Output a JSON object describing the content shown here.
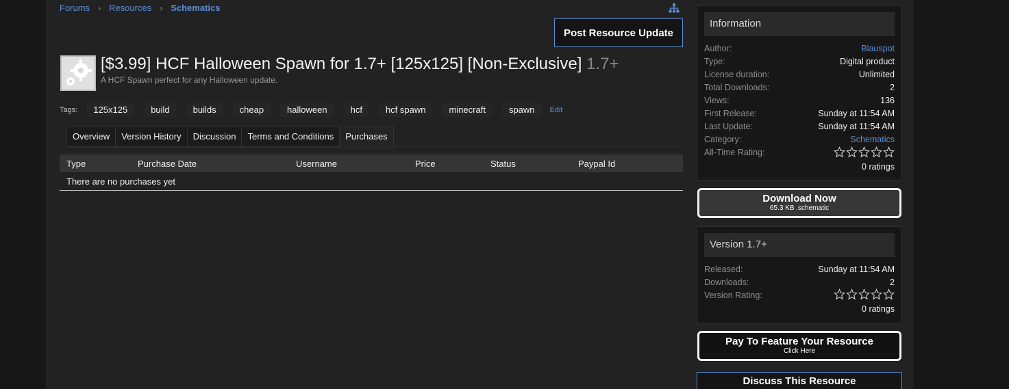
{
  "breadcrumb": {
    "items": [
      "Forums",
      "Resources"
    ],
    "current": "Schematics"
  },
  "post_button": "Post Resource Update",
  "resource": {
    "title": "[$3.99] HCF Halloween Spawn for 1.7+ [125x125] [Non-Exclusive]",
    "version": "1.7+",
    "tagline": "A HCF Spawn perfect for any Halloween update."
  },
  "tags": {
    "label": "Tags:",
    "items": [
      "125x125",
      "build",
      "builds",
      "cheap",
      "halloween",
      "hcf",
      "hcf spawn",
      "minecraft",
      "spawn"
    ],
    "edit": "Edit"
  },
  "tabs": [
    "Overview",
    "Version History",
    "Discussion",
    "Terms and Conditions",
    "Purchases"
  ],
  "table": {
    "columns": [
      "Type",
      "Purchase Date",
      "Username",
      "Price",
      "Status",
      "Paypal Id"
    ],
    "empty": "There are no purchases yet"
  },
  "info": {
    "heading": "Information",
    "rows": [
      {
        "k": "Author:",
        "v": "Blauspot"
      },
      {
        "k": "Type:",
        "v": "Digital product"
      },
      {
        "k": "License duration:",
        "v": "Unlimited"
      },
      {
        "k": "Total Downloads:",
        "v": "2"
      },
      {
        "k": "Views:",
        "v": "136"
      },
      {
        "k": "First Release:",
        "v": "Sunday at 11:54 AM"
      },
      {
        "k": "Last Update:",
        "v": "Sunday at 11:54 AM"
      },
      {
        "k": "Category:",
        "v": "Schematics"
      },
      {
        "k": "All-Time Rating:",
        "v": ""
      }
    ],
    "rating_count": "0 ratings",
    "rating_stars": 0
  },
  "download": {
    "label": "Download Now",
    "sub": "65.3 KB .schematic"
  },
  "version_box": {
    "heading": "Version 1.7+",
    "rows": [
      {
        "k": "Released:",
        "v": "Sunday at 11:54 AM"
      },
      {
        "k": "Downloads:",
        "v": "2"
      },
      {
        "k": "Version Rating:",
        "v": ""
      }
    ],
    "rating_count": "0 ratings",
    "rating_stars": 0
  },
  "feature": {
    "label": "Pay To Feature Your Resource",
    "sub": "Click Here"
  },
  "discuss": "Discuss This Resource",
  "colors": {
    "link": "#5b8fd6",
    "page_bg": "#222222",
    "body_bg": "#171717"
  }
}
